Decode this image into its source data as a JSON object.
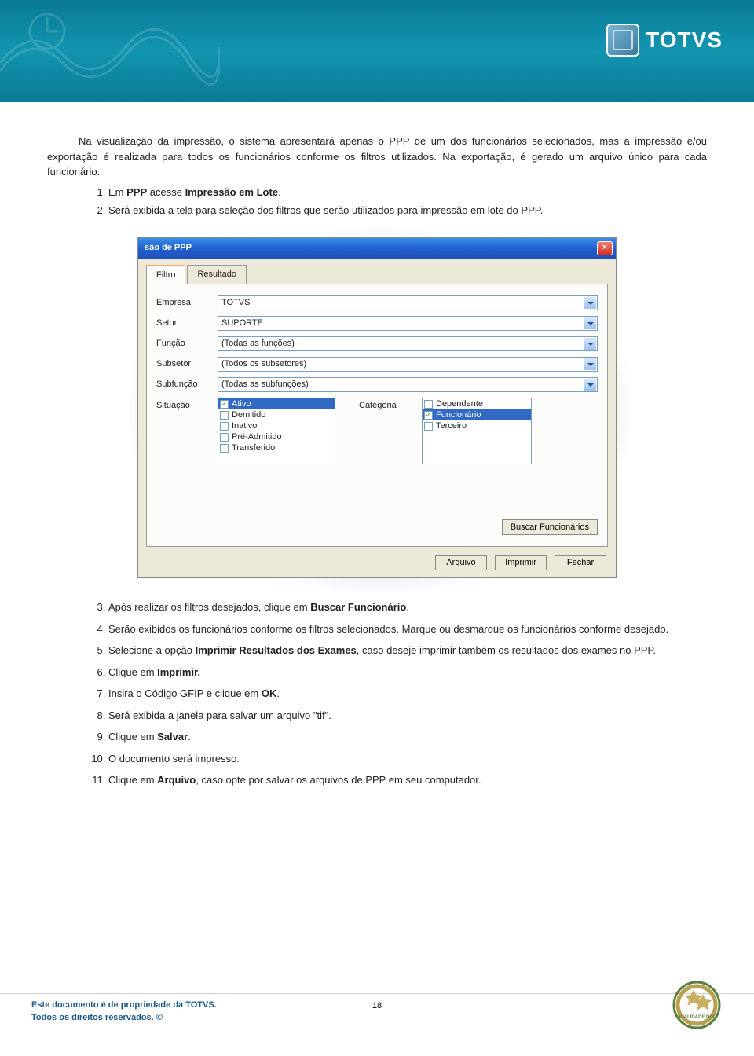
{
  "brand": {
    "name": "TOTVS"
  },
  "body": {
    "p1": "Na visualização da impressão, o sistema apresentará apenas o PPP de um dos funcionários selecionados, mas a impressão e/ou exportação é realizada para todos os funcionários conforme os filtros utilizados. Na exportação, é gerado um arquivo único para cada funcionário.",
    "step1_pre": "Em ",
    "step1_b1": "PPP",
    "step1_mid": " acesse ",
    "step1_b2": "Impressão em Lote",
    "step1_post": ".",
    "step2": "Será exibida a tela para seleção dos filtros que serão utilizados para impressão em lote do PPP.",
    "step3_pre": "Após realizar os filtros desejados, clique em ",
    "step3_b": "Buscar Funcionário",
    "step3_post": ".",
    "step4": "Serão exibidos os funcionários conforme os filtros selecionados. Marque ou desmarque os funcionários conforme desejado.",
    "step5_pre": "Selecione a opção ",
    "step5_b": "Imprimir Resultados dos Exames",
    "step5_post": ", caso deseje imprimir também os resultados dos exames no PPP.",
    "step6_pre": "Clique em ",
    "step6_b": "Imprimir.",
    "step7_pre": "Insira o Código GFIP e clique em ",
    "step7_b": "OK",
    "step7_post": ".",
    "step8": "Será exibida a janela para salvar um arquivo \"tif\".",
    "step9_pre": "Clique em ",
    "step9_b": "Salvar",
    "step9_post": ".",
    "step10": "O documento será impresso.",
    "step11_pre": "Clique em ",
    "step11_b": "Arquivo",
    "step11_post": ", caso opte por salvar os arquivos de PPP em seu computador."
  },
  "dialog": {
    "title": "são de PPP",
    "tabs": [
      "Filtro",
      "Resultado"
    ],
    "labels": {
      "empresa": "Empresa",
      "setor": "Setor",
      "funcao": "Função",
      "subsetor": "Subsetor",
      "subfuncao": "Subfunção",
      "situacao": "Situação",
      "categoria": "Categoria"
    },
    "values": {
      "empresa": "TOTVS",
      "setor": "SUPORTE",
      "funcao": "(Todas as funções)",
      "subsetor": "(Todos os subsetores)",
      "subfuncao": "(Todas as subfunções)"
    },
    "situacao": [
      "Ativo",
      "Demitido",
      "Inativo",
      "Pré-Admitido",
      "Transferido"
    ],
    "categoria": [
      "Dependente",
      "Funcionário",
      "Terceiro"
    ],
    "buttons": {
      "buscar": "Buscar Funcionários",
      "arquivo": "Arquivo",
      "imprimir": "Imprimir",
      "fechar": "Fechar"
    }
  },
  "footer": {
    "l1": "Este documento é de propriedade da TOTVS.",
    "l2": "Todos os direitos reservados. ©",
    "page": "18"
  }
}
